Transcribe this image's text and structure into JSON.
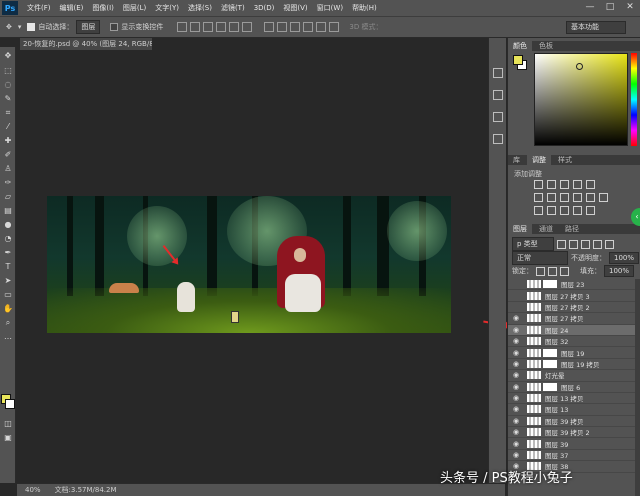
{
  "app": {
    "logo": "Ps"
  },
  "menu": [
    "文件(F)",
    "编辑(E)",
    "图像(I)",
    "图层(L)",
    "文字(Y)",
    "选择(S)",
    "滤镜(T)",
    "3D(D)",
    "视图(V)",
    "窗口(W)",
    "帮助(H)"
  ],
  "window_controls": [
    "—",
    "□",
    "✕"
  ],
  "options": {
    "auto_select_label": "自动选择：",
    "auto_select_checked": true,
    "auto_select_value": "图层",
    "show_transform_label": "显示变换控件",
    "show_transform_checked": false,
    "mode_3d_label": "3D 模式：",
    "workspace": "基本功能"
  },
  "document_tab": "20-恢复的.psd @ 40% (图层 24, RGB/8) *",
  "status": {
    "zoom": "40%",
    "doc_size": "文档:3.57M/84.2M"
  },
  "panels": {
    "color_tabs": [
      "颜色",
      "色板"
    ],
    "adjust_tabs": [
      "库",
      "调整",
      "样式"
    ],
    "adjust_label": "添加调整",
    "layer_tabs": [
      "图层",
      "通道",
      "路径"
    ],
    "filter_kind": "p 类型",
    "blend_mode": "正常",
    "opacity_label": "不透明度：",
    "opacity_value": "100%",
    "lock_label": "锁定：",
    "fill_label": "填充：",
    "fill_value": "100%"
  },
  "layers": [
    {
      "name": "图层 23",
      "visible": false,
      "mask": true,
      "selected": false
    },
    {
      "name": "图层 27 拷贝 3",
      "visible": false,
      "mask": false,
      "selected": false
    },
    {
      "name": "图层 27 拷贝 2",
      "visible": false,
      "mask": false,
      "selected": false
    },
    {
      "name": "图层 27 拷贝",
      "visible": true,
      "mask": false,
      "selected": false
    },
    {
      "name": "图层 24",
      "visible": true,
      "mask": false,
      "selected": true
    },
    {
      "name": "图层 32",
      "visible": true,
      "mask": false,
      "selected": false
    },
    {
      "name": "图层 19",
      "visible": true,
      "mask": true,
      "selected": false
    },
    {
      "name": "图层 19 拷贝",
      "visible": true,
      "mask": true,
      "selected": false
    },
    {
      "name": "灯光晕",
      "visible": true,
      "mask": false,
      "selected": false
    },
    {
      "name": "图层 6",
      "visible": true,
      "mask": true,
      "selected": false
    },
    {
      "name": "图层 13 拷贝",
      "visible": true,
      "mask": false,
      "selected": false
    },
    {
      "name": "图层 13",
      "visible": true,
      "mask": false,
      "selected": false
    },
    {
      "name": "图层 39 拷贝",
      "visible": true,
      "mask": false,
      "selected": false
    },
    {
      "name": "图层 39 拷贝 2",
      "visible": true,
      "mask": false,
      "selected": false
    },
    {
      "name": "图层 39",
      "visible": true,
      "mask": false,
      "selected": false
    },
    {
      "name": "图层 37",
      "visible": true,
      "mask": false,
      "selected": false
    },
    {
      "name": "图层 38",
      "visible": true,
      "mask": false,
      "selected": false
    }
  ],
  "colors": {
    "foreground": "#e8e45a",
    "background": "#ffffff",
    "annotation_arrow": "#e42b2b"
  },
  "watermark": "头条号 / PS教程小兔子"
}
